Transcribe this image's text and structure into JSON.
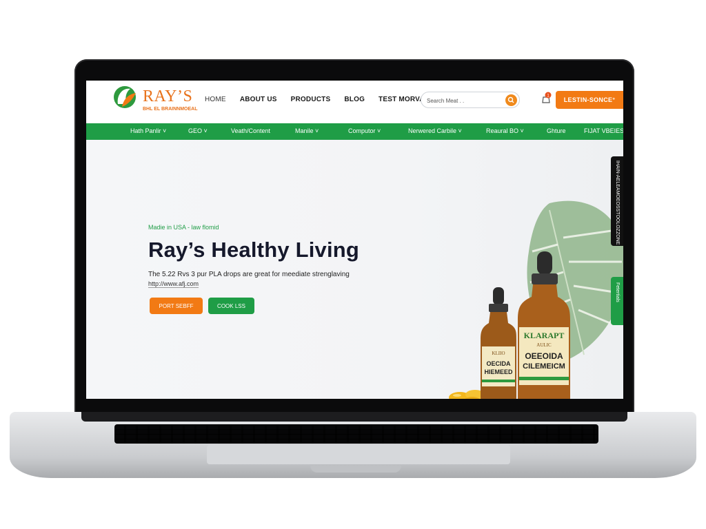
{
  "brand": {
    "name": "RAY’S",
    "tagline": "BHL EL BRAINNMOEAL",
    "colors": {
      "orange": "#f27a14",
      "green": "#1f9d46",
      "dark": "#15182b"
    }
  },
  "nav": [
    "HOME",
    "ABOUT US",
    "PRODUCTS",
    "BLOG",
    "TEST MORVALS"
  ],
  "search": {
    "placeholder": "Search Meat . ."
  },
  "cart": {
    "count": "1"
  },
  "header_cta": "LESTIN-SONCE°",
  "categories": [
    "Hath Panlir ˅",
    "GEO ˅",
    "Veath/Content",
    "Manile ˅",
    "Computor ˅",
    "Nerwered Carbile ˅",
    "Reaural BO ˅",
    "Ghture",
    "FIJAT VBEIES ˅"
  ],
  "hero": {
    "eyebrow": "Madie in USA - law flomid",
    "title": "Ray’s Healthy Living",
    "description": "The 5.22 Rvs 3 pur PLA drops are great for meediate strenglaving",
    "url": "http://www.afj.com",
    "primary_button": "PORT SEBFF",
    "secondary_button": "COOK LSS"
  },
  "product_labels": {
    "small": {
      "line1": "KLIIO",
      "line2": "OECIDA",
      "line3": "HIEMEED"
    },
    "large": {
      "line1": "KLARAPT",
      "line2": "AULIC",
      "line3": "OEEOIDA",
      "line4": "CILEMEICM"
    }
  },
  "side_tabs": {
    "black": "IHAIN-AELEAMOEOSSTOOLOZZONE",
    "green": "Fetertials"
  },
  "icons": [
    "logo-mark-icon",
    "search-icon",
    "cart-icon",
    "leaf-icon",
    "bottle-icon",
    "capsule-icon"
  ]
}
